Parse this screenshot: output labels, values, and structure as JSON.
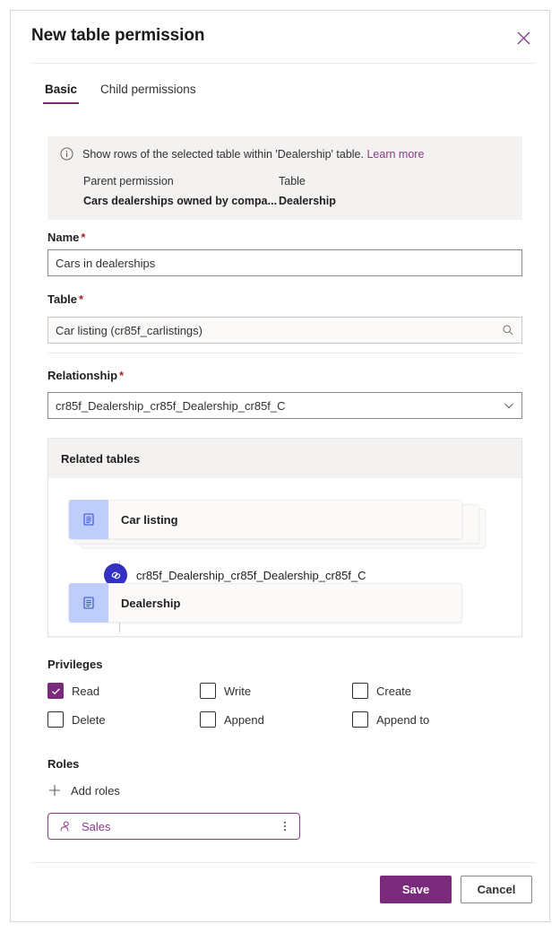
{
  "dialog": {
    "title": "New table permission",
    "close_icon": "close-icon"
  },
  "tabs": [
    {
      "label": "Basic",
      "active": true
    },
    {
      "label": "Child permissions",
      "active": false
    }
  ],
  "info_banner": {
    "icon": "info-icon",
    "message": "Show rows of the selected table within 'Dealership' table.",
    "learn_more": "Learn more",
    "columns": [
      {
        "header": "Parent permission",
        "value": "Cars dealerships owned by compa..."
      },
      {
        "header": "Table",
        "value": "Dealership"
      }
    ]
  },
  "form": {
    "name": {
      "label": "Name",
      "required": "*",
      "value": "Cars in dealerships"
    },
    "table": {
      "label": "Table",
      "required": "*",
      "value": "Car listing (cr85f_carlistings)",
      "icon": "search-icon"
    },
    "relationship": {
      "label": "Relationship",
      "required": "*",
      "value": "cr85f_Dealership_cr85f_Dealership_cr85f_C",
      "icon": "chevron-down-icon"
    }
  },
  "related_tables": {
    "header": "Related tables",
    "source_table": "Car listing",
    "relationship_name": "cr85f_Dealership_cr85f_Dealership_cr85f_C",
    "target_table": "Dealership",
    "table_icon": "table-icon",
    "link_icon": "link-icon"
  },
  "privileges": {
    "label": "Privileges",
    "items": [
      {
        "label": "Read",
        "checked": true
      },
      {
        "label": "Write",
        "checked": false
      },
      {
        "label": "Create",
        "checked": false
      },
      {
        "label": "Delete",
        "checked": false
      },
      {
        "label": "Append",
        "checked": false
      },
      {
        "label": "Append to",
        "checked": false
      }
    ]
  },
  "roles": {
    "label": "Roles",
    "add_label": "Add roles",
    "add_icon": "plus-icon",
    "chips": [
      {
        "label": "Sales",
        "icon": "person-icon",
        "menu_icon": "more-vertical-icon"
      }
    ]
  },
  "footer": {
    "save_label": "Save",
    "cancel_label": "Cancel"
  },
  "colors": {
    "accent_purple": "#7a2a7a",
    "link_purple": "#8a3a8a",
    "required_red": "#a4262c",
    "banner_bg": "#f3f2f1",
    "table_icon_bg": "#bfcdfb",
    "relationship_badge": "#3430c4"
  }
}
